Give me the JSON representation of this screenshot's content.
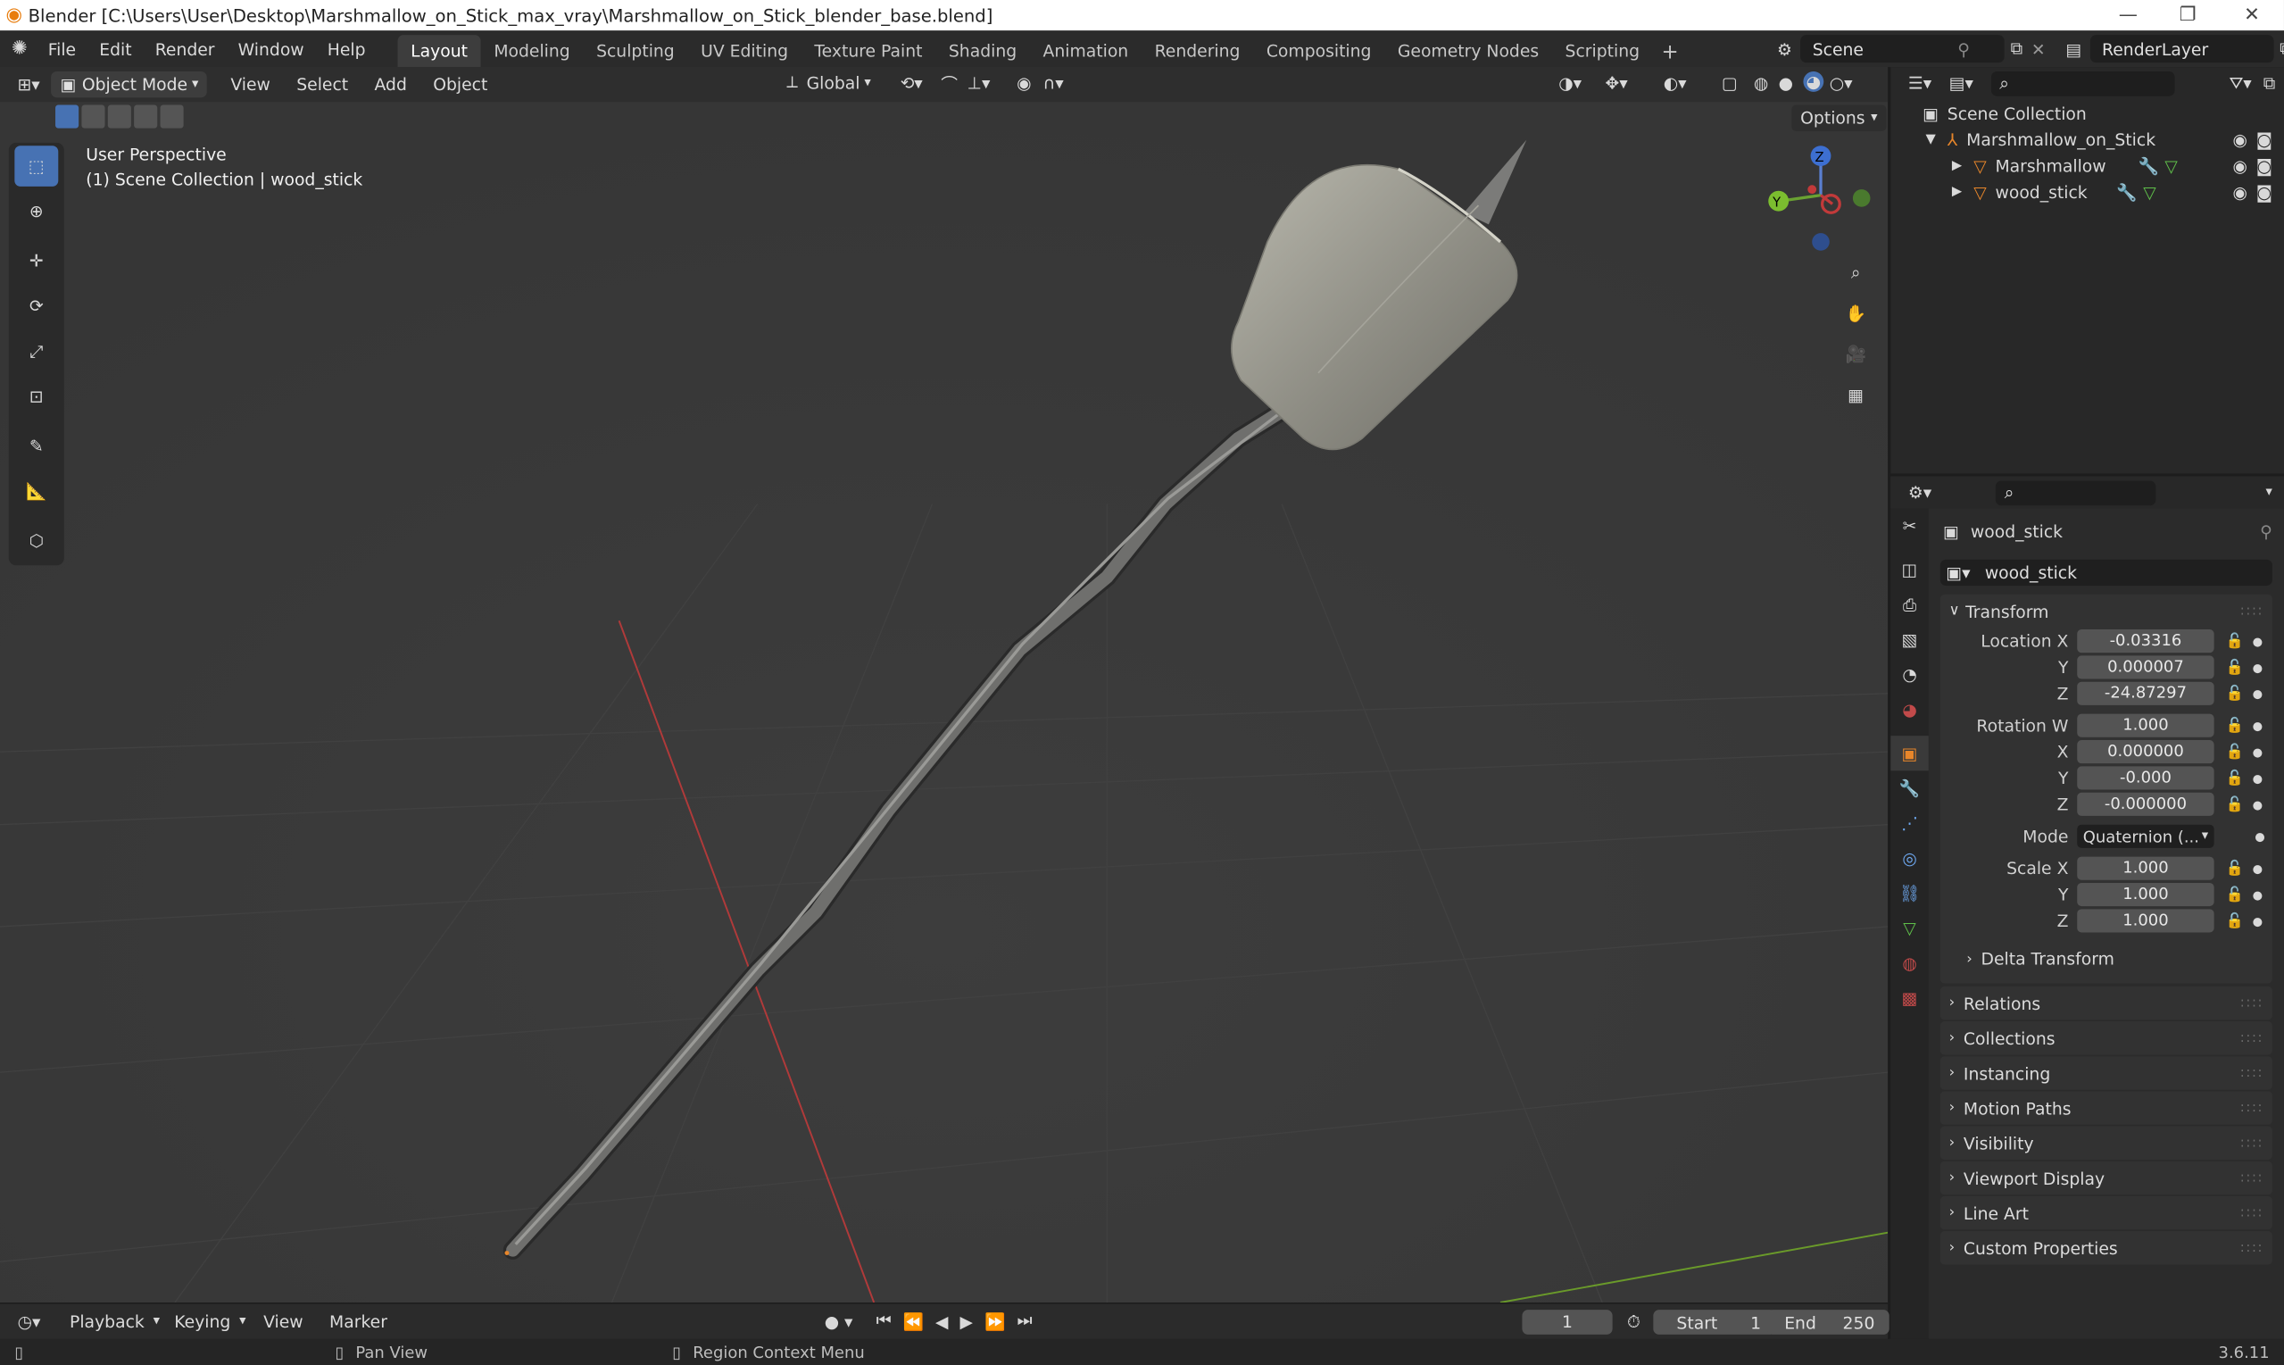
{
  "window": {
    "title": "Blender [C:\\Users\\User\\Desktop\\Marshmallow_on_Stick_max_vray\\Marshmallow_on_Stick_blender_base.blend]"
  },
  "menu": [
    "File",
    "Edit",
    "Render",
    "Window",
    "Help"
  ],
  "workspaces": [
    "Layout",
    "Modeling",
    "Sculpting",
    "UV Editing",
    "Texture Paint",
    "Shading",
    "Animation",
    "Rendering",
    "Compositing",
    "Geometry Nodes",
    "Scripting"
  ],
  "active_workspace": "Layout",
  "scene": {
    "name": "Scene",
    "render_layer": "RenderLayer"
  },
  "viewport": {
    "mode": "Object Mode",
    "menus": [
      "View",
      "Select",
      "Add",
      "Object"
    ],
    "orientation": "Global",
    "options_label": "Options",
    "overlay_title": "User Perspective",
    "overlay_subtitle": "(1) Scene Collection | wood_stick",
    "gizmo": {
      "z": "Z",
      "y": "Y"
    }
  },
  "outliner": {
    "root": "Scene Collection",
    "items": [
      {
        "name": "Marshmallow_on_Stick",
        "level": 1
      },
      {
        "name": "Marshmallow",
        "level": 2
      },
      {
        "name": "wood_stick",
        "level": 2
      }
    ]
  },
  "properties": {
    "object_name": "wood_stick",
    "datablock_name": "wood_stick",
    "transform_label": "Transform",
    "location": {
      "label": "Location X",
      "x": "-0.03316",
      "y": "0.000007",
      "z": "-24.87297"
    },
    "rotation": {
      "label": "Rotation W",
      "w": "1.000",
      "x": "0.000000",
      "y": "-0.000",
      "z": "-0.000000"
    },
    "mode": {
      "label": "Mode",
      "value": "Quaternion (..."
    },
    "scale": {
      "label": "Scale X",
      "x": "1.000",
      "y": "1.000",
      "z": "1.000"
    },
    "axis": {
      "y": "Y",
      "z": "Z",
      "x": "X"
    },
    "delta": "Delta Transform",
    "panels": [
      "Relations",
      "Collections",
      "Instancing",
      "Motion Paths",
      "Visibility",
      "Viewport Display",
      "Line Art",
      "Custom Properties"
    ]
  },
  "timeline": {
    "menus": [
      "Playback",
      "Keying",
      "View",
      "Marker"
    ],
    "current_frame": "1",
    "start_label": "Start",
    "start": "1",
    "end_label": "End",
    "end": "250"
  },
  "status": {
    "pan": "Pan View",
    "context": "Region Context Menu",
    "version": "3.6.11"
  },
  "colors": {
    "accent": "#4772b3",
    "object_orange": "#e8862a",
    "mesh_green": "#5fbf4a",
    "axis_red": "#c23a3a",
    "axis_green": "#6a9a2a"
  }
}
